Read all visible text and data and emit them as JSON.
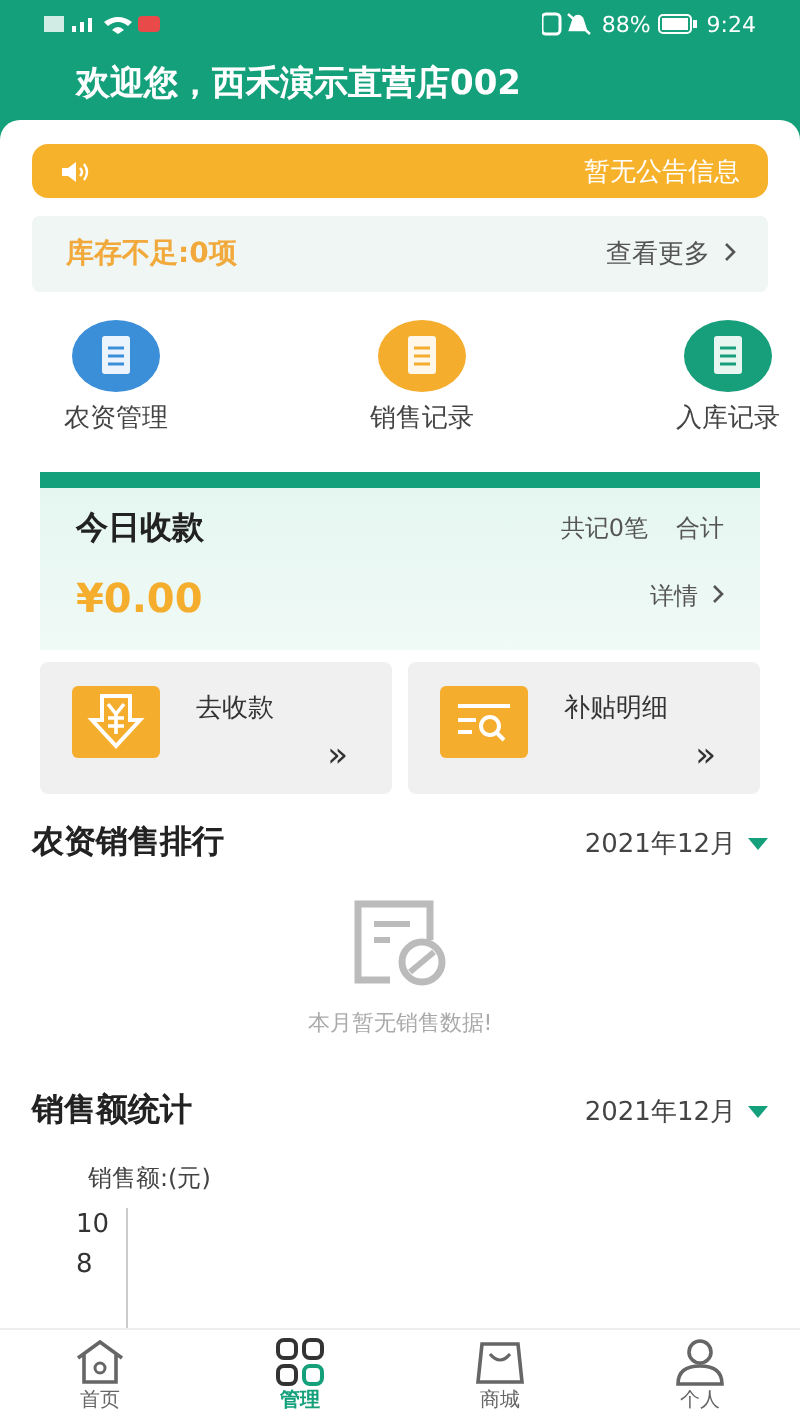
{
  "status_bar": {
    "battery": "88%",
    "time": "9:24"
  },
  "header": {
    "title": "欢迎您，西禾演示直营店002"
  },
  "notice": {
    "text": "暂无公告信息"
  },
  "stock": {
    "text": "库存不足:0项",
    "link": "查看更多"
  },
  "shortcuts": [
    {
      "label": "农资管理",
      "color": "#3b8fd9"
    },
    {
      "label": "销售记录",
      "color": "#f5ad2d"
    },
    {
      "label": "入库记录",
      "color": "#179e7a"
    }
  ],
  "today": {
    "title": "今日收款",
    "count": "共记0笔",
    "total_label": "合计",
    "amount": "¥0.00",
    "detail": "详情"
  },
  "actions": [
    {
      "label": "去收款",
      "kind": "collect",
      "arrow": "»"
    },
    {
      "label": "补贴明细",
      "kind": "subsidy",
      "arrow": "»"
    }
  ],
  "ranking": {
    "title": "农资销售排行",
    "month": "2021年12月",
    "empty": "本月暂无销售数据!"
  },
  "stats": {
    "title": "销售额统计",
    "month": "2021年12月",
    "y_title": "销售额:(元)",
    "y_ticks": [
      "10",
      "8"
    ]
  },
  "tabs": [
    {
      "label": "首页",
      "kind": "home",
      "selected": false
    },
    {
      "label": "管理",
      "kind": "manage",
      "selected": true
    },
    {
      "label": "商城",
      "kind": "shop",
      "selected": false
    },
    {
      "label": "个人",
      "kind": "person",
      "selected": false
    }
  ]
}
